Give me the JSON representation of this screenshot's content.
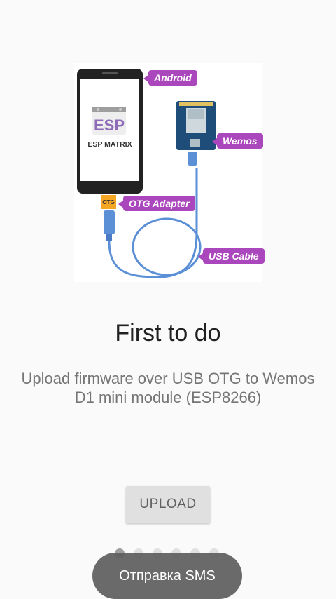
{
  "illustration": {
    "app_name": "ESP MATRIX",
    "logo_text": "ESP",
    "otg_label": "OTG",
    "callouts": {
      "android": "Android",
      "wemos": "Wemos",
      "otg_adapter": "OTG Adapter",
      "usb_cable": "USB Cable"
    }
  },
  "slide": {
    "title": "First to do",
    "description": "Upload firmware over USB OTG to Wemos D1 mini module (ESP8266)"
  },
  "upload_button": {
    "label": "UPLOAD"
  },
  "pager": {
    "total": 6,
    "current": 1
  },
  "toast": {
    "text": "Отправка SMS"
  },
  "colors": {
    "callout": "#ab47bc",
    "board": "#1e4d7a",
    "cable": "#5b8fd6",
    "otg": "#f5a623"
  }
}
